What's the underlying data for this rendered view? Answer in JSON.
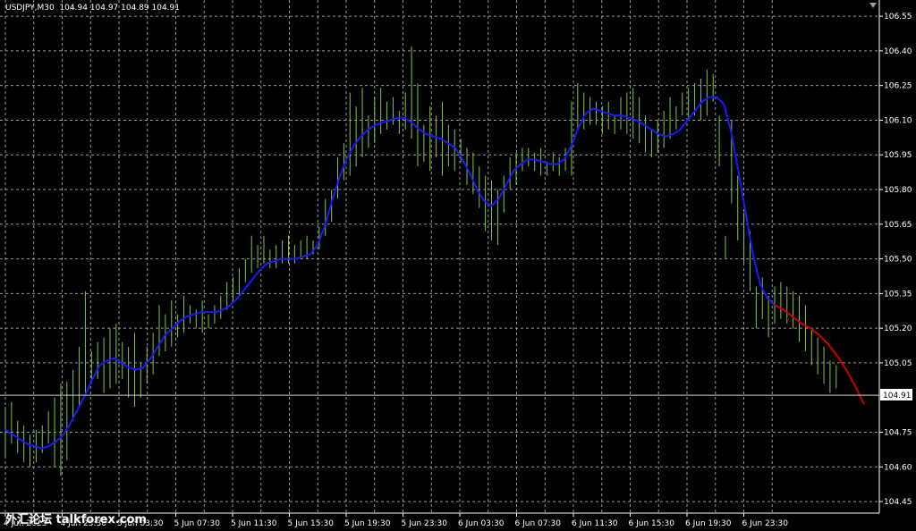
{
  "symbol": {
    "name": "USDJPY,M30",
    "ohlc": "104.94 104.97 104.89 104.91"
  },
  "current_price_label": "104.91",
  "watermark": "外汇论坛 talkforex.com",
  "colors": {
    "background": "#000000",
    "grid": "#9a9a9a",
    "bars": "#7ec83a",
    "ma_line": "#1a1aff",
    "projection": "#cc0000",
    "axis": "#ffffff"
  },
  "chart_data": {
    "type": "line",
    "title": "",
    "ylim": [
      104.4,
      106.62
    ],
    "y_ticks": [
      "106.55",
      "106.40",
      "106.25",
      "106.10",
      "105.95",
      "105.80",
      "105.65",
      "105.50",
      "105.35",
      "105.20",
      "105.05",
      "104.75",
      "104.60",
      "104.45"
    ],
    "x_ticks": [
      "4 Jun 2023",
      "4 Jun 23:30",
      "5 Jun 03:30",
      "5 Jun 07:30",
      "5 Jun 11:30",
      "5 Jun 15:30",
      "5 Jun 19:30",
      "5 Jun 23:30",
      "6 Jun 03:30",
      "6 Jun 07:30",
      "6 Jun 11:30",
      "6 Jun 15:30",
      "6 Jun 19:30",
      "6 Jun 23:30"
    ],
    "current_price": 104.91,
    "bars": [
      [
        104.86,
        104.64
      ],
      [
        104.88,
        104.7
      ],
      [
        104.8,
        104.66
      ],
      [
        104.78,
        104.62
      ],
      [
        104.74,
        104.6
      ],
      [
        104.76,
        104.62
      ],
      [
        104.78,
        104.66
      ],
      [
        104.84,
        104.7
      ],
      [
        104.9,
        104.6
      ],
      [
        104.96,
        104.56
      ],
      [
        104.97,
        104.63
      ],
      [
        105.02,
        104.8
      ],
      [
        105.12,
        104.86
      ],
      [
        105.36,
        104.92
      ],
      [
        105.1,
        104.96
      ],
      [
        105.14,
        104.98
      ],
      [
        105.16,
        104.92
      ],
      [
        105.2,
        104.94
      ],
      [
        105.22,
        104.96
      ],
      [
        105.14,
        104.98
      ],
      [
        105.12,
        104.9
      ],
      [
        105.18,
        104.86
      ],
      [
        105.05,
        104.9
      ],
      [
        105.12,
        104.96
      ],
      [
        105.18,
        105.0
      ],
      [
        105.3,
        105.08
      ],
      [
        105.26,
        105.1
      ],
      [
        105.32,
        105.12
      ],
      [
        105.26,
        105.16
      ],
      [
        105.34,
        105.18
      ],
      [
        105.3,
        105.22
      ],
      [
        105.28,
        105.2
      ],
      [
        105.32,
        105.18
      ],
      [
        105.26,
        105.2
      ],
      [
        105.3,
        105.22
      ],
      [
        105.34,
        105.24
      ],
      [
        105.4,
        105.28
      ],
      [
        105.42,
        105.32
      ],
      [
        105.46,
        105.34
      ],
      [
        105.5,
        105.4
      ],
      [
        105.6,
        105.44
      ],
      [
        105.56,
        105.46
      ],
      [
        105.6,
        105.48
      ],
      [
        105.54,
        105.46
      ],
      [
        105.56,
        105.46
      ],
      [
        105.58,
        105.48
      ],
      [
        105.6,
        105.48
      ],
      [
        105.56,
        105.48
      ],
      [
        105.58,
        105.5
      ],
      [
        105.6,
        105.5
      ],
      [
        105.58,
        105.52
      ],
      [
        105.64,
        105.54
      ],
      [
        105.76,
        105.6
      ],
      [
        105.8,
        105.66
      ],
      [
        105.94,
        105.76
      ],
      [
        106.0,
        105.84
      ],
      [
        106.22,
        105.86
      ],
      [
        106.16,
        105.9
      ],
      [
        106.24,
        105.94
      ],
      [
        106.12,
        105.98
      ],
      [
        106.2,
        106.0
      ],
      [
        106.24,
        106.04
      ],
      [
        106.18,
        106.06
      ],
      [
        106.2,
        106.08
      ],
      [
        106.14,
        106.04
      ],
      [
        106.22,
        106.06
      ],
      [
        106.42,
        106.02
      ],
      [
        106.26,
        105.9
      ],
      [
        106.08,
        105.92
      ],
      [
        106.16,
        105.88
      ],
      [
        106.12,
        105.94
      ],
      [
        106.18,
        105.86
      ],
      [
        106.08,
        105.9
      ],
      [
        106.06,
        105.88
      ],
      [
        106.02,
        105.92
      ],
      [
        105.98,
        105.82
      ],
      [
        105.96,
        105.78
      ],
      [
        105.9,
        105.72
      ],
      [
        105.86,
        105.62
      ],
      [
        105.84,
        105.58
      ],
      [
        105.8,
        105.56
      ],
      [
        105.86,
        105.7
      ],
      [
        105.94,
        105.8
      ],
      [
        105.96,
        105.82
      ],
      [
        105.98,
        105.88
      ],
      [
        105.98,
        105.9
      ],
      [
        105.96,
        105.88
      ],
      [
        105.98,
        105.86
      ],
      [
        105.92,
        105.86
      ],
      [
        105.96,
        105.88
      ],
      [
        105.94,
        105.86
      ],
      [
        105.98,
        105.88
      ],
      [
        106.18,
        105.86
      ],
      [
        106.26,
        106.06
      ],
      [
        106.22,
        106.06
      ],
      [
        106.2,
        106.08
      ],
      [
        106.18,
        106.08
      ],
      [
        106.16,
        106.04
      ],
      [
        106.18,
        106.06
      ],
      [
        106.12,
        106.04
      ],
      [
        106.2,
        106.06
      ],
      [
        106.22,
        106.04
      ],
      [
        106.24,
        106.02
      ],
      [
        106.2,
        106.0
      ],
      [
        106.12,
        105.96
      ],
      [
        106.06,
        105.94
      ],
      [
        106.1,
        105.96
      ],
      [
        106.14,
        105.98
      ],
      [
        106.2,
        106.02
      ],
      [
        106.16,
        106.06
      ],
      [
        106.22,
        106.12
      ],
      [
        106.24,
        106.1
      ],
      [
        106.26,
        106.12
      ],
      [
        106.28,
        106.1
      ],
      [
        106.32,
        106.12
      ],
      [
        106.3,
        106.18
      ],
      [
        106.12,
        105.9
      ],
      [
        105.6,
        105.5
      ],
      [
        106.1,
        105.74
      ],
      [
        105.86,
        105.58
      ],
      [
        105.7,
        105.48
      ],
      [
        105.62,
        105.36
      ],
      [
        105.38,
        105.2
      ],
      [
        105.42,
        105.24
      ],
      [
        105.34,
        105.16
      ],
      [
        105.38,
        105.22
      ],
      [
        105.4,
        105.24
      ],
      [
        105.38,
        105.22
      ],
      [
        105.36,
        105.2
      ],
      [
        105.34,
        105.14
      ],
      [
        105.3,
        105.1
      ],
      [
        105.2,
        105.04
      ],
      [
        105.16,
        105.0
      ],
      [
        105.12,
        104.96
      ],
      [
        105.06,
        104.92
      ],
      [
        105.04,
        104.94
      ]
    ],
    "ma": [
      104.76,
      104.74,
      104.72,
      104.7,
      104.69,
      104.68,
      104.69,
      104.71,
      104.74,
      104.79,
      104.85,
      104.91,
      104.98,
      105.04,
      105.06,
      105.07,
      105.05,
      105.03,
      105.02,
      105.03,
      105.07,
      105.12,
      105.17,
      105.2,
      105.23,
      105.25,
      105.26,
      105.27,
      105.27,
      105.27,
      105.28,
      105.3,
      105.33,
      105.37,
      105.41,
      105.45,
      105.48,
      105.49,
      105.5,
      105.5,
      105.5,
      105.51,
      105.52,
      105.56,
      105.64,
      105.75,
      105.85,
      105.93,
      105.99,
      106.03,
      106.06,
      106.08,
      106.09,
      106.1,
      106.11,
      106.11,
      106.09,
      106.06,
      106.04,
      106.03,
      106.02,
      106.0,
      105.98,
      105.93,
      105.87,
      105.8,
      105.75,
      105.73,
      105.76,
      105.82,
      105.88,
      105.91,
      105.93,
      105.93,
      105.92,
      105.91,
      105.91,
      105.93,
      105.99,
      106.07,
      106.13,
      106.15,
      106.14,
      106.13,
      106.12,
      106.12,
      106.11,
      106.1,
      106.08,
      106.06,
      106.04,
      106.03,
      106.04,
      106.06,
      106.1,
      106.14,
      106.18,
      106.2,
      106.2,
      106.17,
      106.05,
      105.88,
      105.7,
      105.52,
      105.39,
      105.33,
      105.3
    ],
    "projection": [
      105.3,
      105.28,
      105.25,
      105.22,
      105.2,
      105.17,
      105.13,
      105.08,
      105.02,
      104.95,
      104.87
    ]
  }
}
